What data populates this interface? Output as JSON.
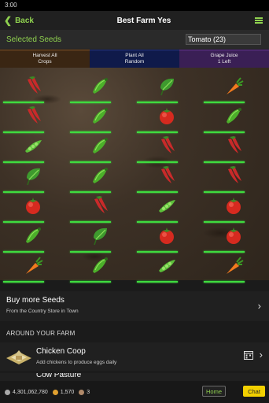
{
  "status": {
    "time": "3:00"
  },
  "header": {
    "back_label": "Back",
    "title": "Best Farm Yes"
  },
  "seeds": {
    "label": "Selected Seeds",
    "selected_value": "Tomato (23)"
  },
  "actions": [
    {
      "line1": "Harvest All",
      "line2": "Crops"
    },
    {
      "line1": "Plant All",
      "line2": "Random"
    },
    {
      "line1": "Grape Juice",
      "line2": "1 Left"
    }
  ],
  "farm": {
    "plots": [
      [
        "chili-pepper",
        "cucumber",
        "spinach",
        "carrot"
      ],
      [
        "chili-pepper",
        "cucumber",
        "tomato",
        "cucumber"
      ],
      [
        "pea-pod",
        "cucumber",
        "chili-pepper",
        "chili-pepper"
      ],
      [
        "spinach",
        "cucumber",
        "chili-pepper",
        "chili-pepper"
      ],
      [
        "tomato",
        "chili-pepper",
        "pea-pod",
        "tomato"
      ],
      [
        "cucumber",
        "spinach",
        "tomato",
        "tomato"
      ],
      [
        "carrot",
        "cucumber",
        "pea-pod",
        "carrot"
      ]
    ],
    "icon_colors": {
      "tomato": "#d62a1f",
      "chili-pepper": "#c92a2a",
      "cucumber": "#4caf2a",
      "pea-pod": "#5cbf3a",
      "spinach": "#3e9a2e",
      "carrot": "#f07a1e"
    },
    "bar_color": "#3fdb3f"
  },
  "buy_more": {
    "title": "Buy more Seeds",
    "subtitle": "From the Country Store in Town"
  },
  "around": {
    "heading": "AROUND YOUR FARM",
    "items": [
      {
        "title": "Chicken Coop",
        "subtitle": "Add chickens to produce eggs daily"
      },
      {
        "title": "Cow Pasture",
        "subtitle": ""
      }
    ]
  },
  "bottom": {
    "coins": "4,301,062,780",
    "seeds": "1,570",
    "eggs": "3",
    "home_label": "Home",
    "chat_label": "Chat"
  },
  "colors": {
    "accent": "#8fd14f",
    "chat_bg": "#f2d000"
  }
}
